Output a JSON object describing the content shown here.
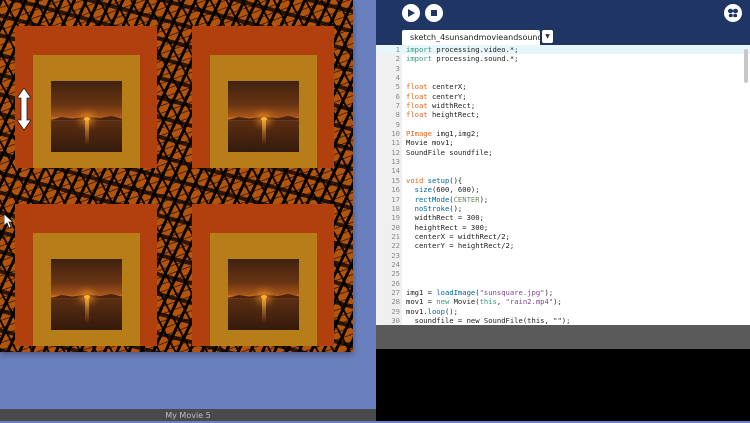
{
  "sketch_window": {
    "canvas_name": "sketch output",
    "tiles": 4
  },
  "movie_bar": {
    "title": "My Movie 5"
  },
  "ide": {
    "tab_label": "sketch_4sunsandmovieandsound",
    "tab_menu_icon": "triangle-down-icon",
    "toolbar": {
      "run_icon": "play-icon",
      "stop_icon": "stop-icon",
      "mode_icon": "butterfly-icon"
    },
    "current_line": 1,
    "code_lines": [
      [
        {
          "t": "import",
          "c": "kw"
        },
        {
          "t": " processing.video.*;"
        }
      ],
      [
        {
          "t": "import",
          "c": "kw"
        },
        {
          "t": " processing.sound.*;"
        }
      ],
      [],
      [],
      [
        {
          "t": "float",
          "c": "ty"
        },
        {
          "t": " centerX;"
        }
      ],
      [
        {
          "t": "float",
          "c": "ty"
        },
        {
          "t": " centerY;"
        }
      ],
      [
        {
          "t": "float",
          "c": "ty"
        },
        {
          "t": " widthRect;"
        }
      ],
      [
        {
          "t": "float",
          "c": "ty"
        },
        {
          "t": " heightRect;"
        }
      ],
      [],
      [
        {
          "t": "PImage",
          "c": "ty"
        },
        {
          "t": " img1,img2;"
        }
      ],
      [
        {
          "t": "Movie mov1;"
        }
      ],
      [
        {
          "t": "SoundFile soundfile;"
        }
      ],
      [],
      [],
      [
        {
          "t": "void",
          "c": "ty"
        },
        {
          "t": " "
        },
        {
          "t": "setup",
          "c": "fn"
        },
        {
          "t": "(){"
        }
      ],
      [
        {
          "t": "  "
        },
        {
          "t": "size",
          "c": "fn"
        },
        {
          "t": "(600, 600);"
        }
      ],
      [
        {
          "t": "  "
        },
        {
          "t": "rectMode",
          "c": "fn"
        },
        {
          "t": "("
        },
        {
          "t": "CENTER",
          "c": "lit"
        },
        {
          "t": ");"
        }
      ],
      [
        {
          "t": "  "
        },
        {
          "t": "noStroke",
          "c": "fn"
        },
        {
          "t": "();"
        }
      ],
      [
        {
          "t": "  widthRect = 300;"
        }
      ],
      [
        {
          "t": "  heightRect = 300;"
        }
      ],
      [
        {
          "t": "  centerX = widthRect/2;"
        }
      ],
      [
        {
          "t": "  centerY = heightRect/2;"
        }
      ],
      [],
      [],
      [],
      [],
      [
        {
          "t": "img1 = "
        },
        {
          "t": "loadImage",
          "c": "fn"
        },
        {
          "t": "("
        },
        {
          "t": "\"sunsquare.jpg\"",
          "c": "str"
        },
        {
          "t": ");"
        }
      ],
      [
        {
          "t": "mov1 = "
        },
        {
          "t": "new",
          "c": "kw"
        },
        {
          "t": " Movie("
        },
        {
          "t": "this",
          "c": "kw"
        },
        {
          "t": ", "
        },
        {
          "t": "\"rain2.mp4\"",
          "c": "str"
        },
        {
          "t": ");"
        }
      ],
      [
        {
          "t": "mov1."
        },
        {
          "t": "loop",
          "c": "fn"
        },
        {
          "t": "();"
        }
      ],
      [
        {
          "t": "  soundfile = new SoundFile(this, \"\");"
        }
      ]
    ]
  },
  "icons": {
    "resize_cursor": "vertical-resize-cursor-icon",
    "arrow_cursor": "arrow-cursor-icon"
  }
}
